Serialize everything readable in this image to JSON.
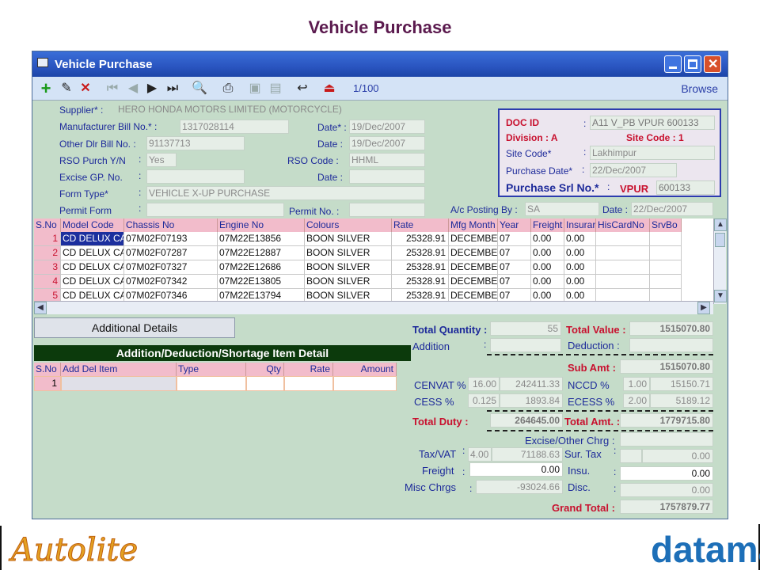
{
  "slide_title": "Vehicle Purchase",
  "window": {
    "title": "Vehicle Purchase"
  },
  "toolbar": {
    "record": "1/100",
    "mode": "Browse"
  },
  "form": {
    "supplier_label": "Supplier* :",
    "supplier": "HERO HONDA MOTORS LIMITED (MOTORCYCLE)",
    "mfr_bill_label": "Manufacturer Bill No.* :",
    "mfr_bill": "1317028114",
    "date1_label": "Date* :",
    "date1": "19/Dec/2007",
    "other_bill_label": "Other Dlr Bill No. :",
    "other_bill": "91137713",
    "date2_label": "Date :",
    "date2": "19/Dec/2007",
    "rso_label": "RSO Purch Y/N",
    "rso": "Yes",
    "rso_code_label": "RSO Code :",
    "rso_code": "HHML",
    "excise_label": "Excise GP. No.",
    "date3_label": "Date :",
    "form_type_label": "Form Type*",
    "form_type": "VEHICLE X-UP PURCHASE",
    "permit_form_label": "Permit Form",
    "permit_no_label": "Permit No. :",
    "ac_posting_label": "A/c Posting By :",
    "ac_posting": "SA",
    "date4_label": "Date :",
    "date4": "22/Dec/2007"
  },
  "doc": {
    "doc_id_label": "DOC ID",
    "doc_id": "A11 V_PB VPUR  600133",
    "division": "Division : A",
    "site_code_red": "Site Code : 1",
    "site_code_label": "Site Code*",
    "site_code": "Lakhimpur",
    "purchase_date_label": "Purchase Date*",
    "purchase_date": "22/Dec/2007",
    "srl_label": "Purchase Srl No.*",
    "srl_prefix": "VPUR",
    "srl": "600133"
  },
  "grid": {
    "columns": [
      "S.No",
      "Model Code",
      "Chassis No",
      "Engine No",
      "Colours",
      "Rate",
      "Mfg Month",
      "Year",
      "Freight",
      "Insurar",
      "HisCardNo",
      "SrvBo"
    ],
    "rows": [
      [
        "1",
        "CD DELUX CAST",
        "07M02F07193",
        "07M22E13856",
        "BOON SILVER",
        "25328.91",
        "DECEMBE",
        "07",
        "0.00",
        "0.00"
      ],
      [
        "2",
        "CD DELUX CAST",
        "07M02F07287",
        "07M22E12887",
        "BOON SILVER",
        "25328.91",
        "DECEMBE",
        "07",
        "0.00",
        "0.00"
      ],
      [
        "3",
        "CD DELUX CAST",
        "07M02F07327",
        "07M22E12686",
        "BOON SILVER",
        "25328.91",
        "DECEMBE",
        "07",
        "0.00",
        "0.00"
      ],
      [
        "4",
        "CD DELUX CAST",
        "07M02F07342",
        "07M22E13805",
        "BOON SILVER",
        "25328.91",
        "DECEMBE",
        "07",
        "0.00",
        "0.00"
      ],
      [
        "5",
        "CD DELUX CAST",
        "07M02F07346",
        "07M22E13794",
        "BOON SILVER",
        "25328.91",
        "DECEMBE",
        "07",
        "0.00",
        "0.00"
      ]
    ]
  },
  "additional": {
    "button": "Additional Details",
    "header": "Addition/Deduction/Shortage Item Detail",
    "columns": [
      "S.No",
      "Add Del Item",
      "Type",
      "Qty",
      "Rate",
      "Amount"
    ],
    "row1_sno": "1"
  },
  "totals": {
    "total_qty_label": "Total Quantity :",
    "total_qty": "55",
    "total_value_label": "Total Value :",
    "total_value": "1515070.80",
    "addition_label": "Addition",
    "deduction_label": "Deduction :",
    "sub_amt_label": "Sub Amt :",
    "sub_amt": "1515070.80",
    "cenvat_label": "CENVAT %",
    "cenvat_pct": "16.00",
    "cenvat": "242411.33",
    "nccd_label": "NCCD  %",
    "nccd_pct": "1.00",
    "nccd": "15150.71",
    "cess_label": "CESS    %",
    "cess_pct": "0.125",
    "cess": "1893.84",
    "ecess_label": "ECESS %",
    "ecess_pct": "2.00",
    "ecess": "5189.12",
    "total_duty_label": "Total Duty :",
    "total_duty": "264645.00",
    "total_amt_label": "Total Amt. :",
    "total_amt": "1779715.80",
    "excise_other_label": "Excise/Other Chrg :",
    "taxvat_label": "Tax/VAT",
    "taxvat_pct": "4.00",
    "taxvat": "71188.63",
    "surtax_label": "Sur. Tax",
    "surtax": "0.00",
    "freight_label": "Freight",
    "freight": "0.00",
    "insu_label": "Insu.",
    "insu": "0.00",
    "misc_label": "Misc Chrgs",
    "misc": "-93024.66",
    "disc_label": "Disc.",
    "disc": "0.00",
    "grand_total_label": "Grand Total :",
    "grand_total": "1757879.77"
  },
  "logos": {
    "left": "Autolite",
    "right": "dataman"
  }
}
